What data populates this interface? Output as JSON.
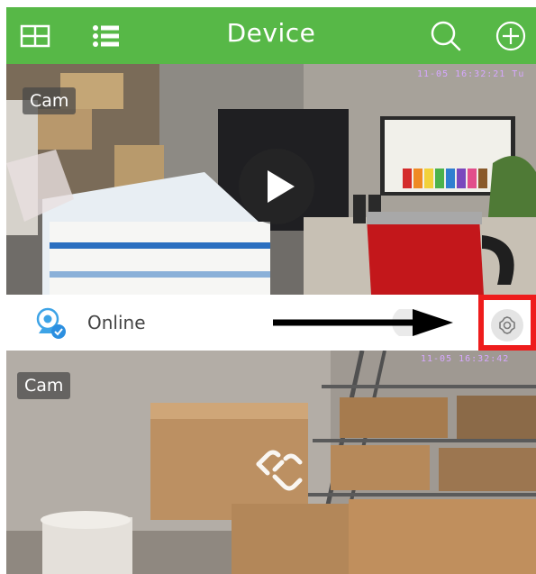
{
  "header": {
    "title": "Device",
    "grid_view_icon": "grid-icon",
    "list_view_icon": "list-icon",
    "search_icon": "search-icon",
    "add_icon": "add-circle-icon",
    "background_color": "#57b847"
  },
  "devices": [
    {
      "name": "Cam",
      "timestamp": "11-05 16:32:21 Tu",
      "status": "Online",
      "status_icon": "camera-online-icon",
      "play_icon": "play-icon"
    },
    {
      "name": "Cam",
      "timestamp": "11-05 16:32:42",
      "status_icon": "broken-link-icon"
    }
  ],
  "annotations": {
    "arrow": "arrow-right-icon",
    "highlight_color": "#ee1c1c",
    "highlighted_control": "settings-gear-icon"
  }
}
